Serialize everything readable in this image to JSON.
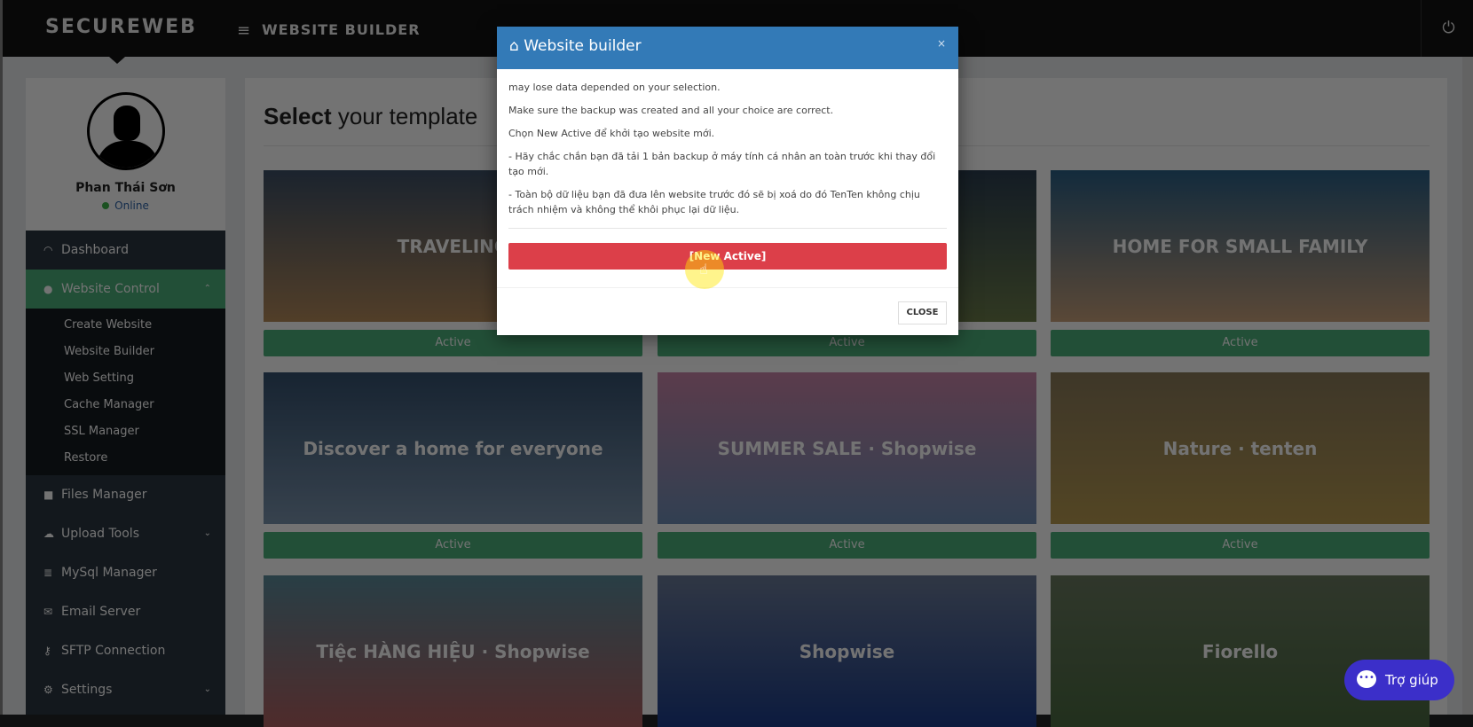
{
  "topbar": {
    "brand": "SECUREWEB",
    "page_title": "WEBSITE BUILDER",
    "menu_icon": "hamburger-icon",
    "power_icon": "power-icon"
  },
  "profile": {
    "name": "Phan Thái Sơn",
    "status": "Online"
  },
  "sidebar": {
    "items": [
      {
        "label": "Dashboard",
        "icon": "dashboard-icon"
      },
      {
        "label": "Website Control",
        "icon": "globe-icon",
        "active": true,
        "sub": [
          "Create Website",
          "Website Builder",
          "Web Setting",
          "Cache Manager",
          "SSL Manager",
          "Restore"
        ]
      },
      {
        "label": "Files Manager",
        "icon": "folder-icon"
      },
      {
        "label": "Upload Tools",
        "icon": "upload-icon"
      },
      {
        "label": "MySql Manager",
        "icon": "database-icon"
      },
      {
        "label": "Email Server",
        "icon": "envelope-icon"
      },
      {
        "label": "SFTP Connection",
        "icon": "key-icon"
      },
      {
        "label": "Settings",
        "icon": "gears-icon"
      }
    ]
  },
  "main": {
    "title_bold": "Select",
    "title_rest": " your template",
    "templates": [
      {
        "caption": "TRAVELING",
        "button": "Active"
      },
      {
        "caption": "",
        "button": "Active"
      },
      {
        "caption": "HOME FOR SMALL FAMILY",
        "button": "Active"
      },
      {
        "caption": "Discover a home for everyone",
        "button": "Active"
      },
      {
        "caption": "SUMMER SALE · Shopwise",
        "button": "Active"
      },
      {
        "caption": "Nature · tenten",
        "button": "Active"
      },
      {
        "caption": "Tiệc HÀNG HIỆU · Shopwise",
        "button": ""
      },
      {
        "caption": "Shopwise",
        "button": ""
      },
      {
        "caption": "Fiorello",
        "button": ""
      }
    ]
  },
  "modal": {
    "title": "Website builder",
    "close_x": "×",
    "lines": [
      "may lose data depended on your selection.",
      "Make sure the backup was created and all your choice are correct.",
      "Chọn New Active để khởi tạo website mới.",
      "- Hãy chắc chắn bạn đã tải 1 bản backup ở máy tính cá nhân an toàn trước khi thay đổi tạo mới.",
      "- Toàn bộ dữ liệu bạn đã đưa lên website trước đó sẽ bị xoá do đó TenTen không chịu trách nhiệm và không thể khôi phục lại dữ liệu."
    ],
    "primary": "[New Active]",
    "close": "CLOSE"
  },
  "help": {
    "label": "Trợ giúp"
  },
  "colors": {
    "accent_green": "#4caf7a",
    "modal_header": "#337ab7",
    "danger": "#dc3f49",
    "help": "#3b2fc9"
  }
}
